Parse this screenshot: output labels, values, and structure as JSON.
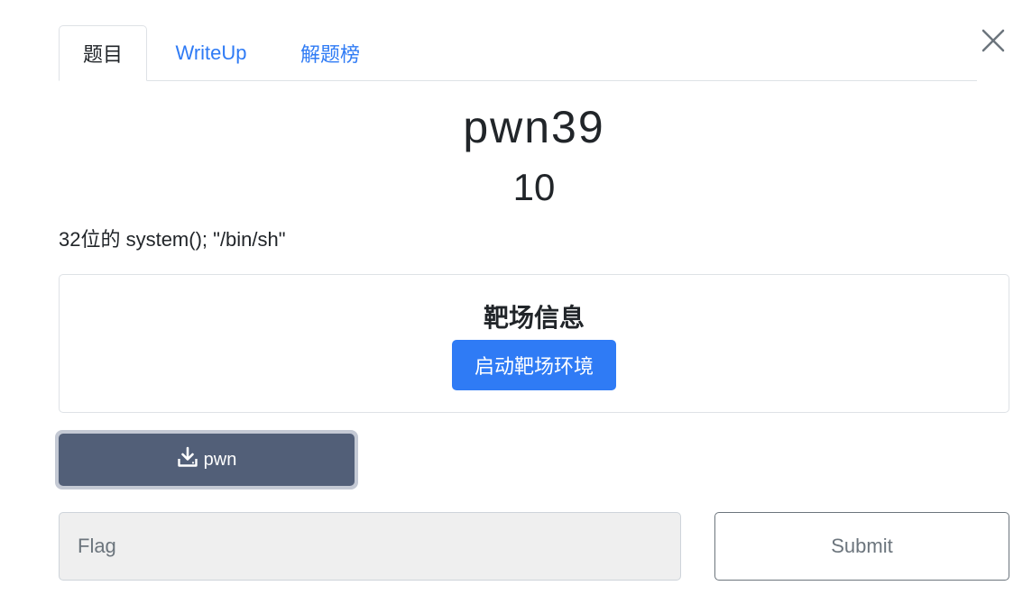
{
  "tabs": [
    {
      "label": "题目",
      "active": true
    },
    {
      "label": "WriteUp",
      "active": false
    },
    {
      "label": "解题榜",
      "active": false
    }
  ],
  "challenge": {
    "title": "pwn39",
    "score": "10",
    "description": "32位的 system(); \"/bin/sh\""
  },
  "range": {
    "title": "靶场信息",
    "start_button": "启动靶场环境"
  },
  "download": {
    "label": "pwn",
    "icon": "download-icon"
  },
  "flag": {
    "placeholder": "Flag",
    "value": ""
  },
  "submit": {
    "label": "Submit"
  },
  "colors": {
    "accent": "#2f7bf5",
    "download_bg": "#525f78",
    "input_bg": "#efefef"
  }
}
